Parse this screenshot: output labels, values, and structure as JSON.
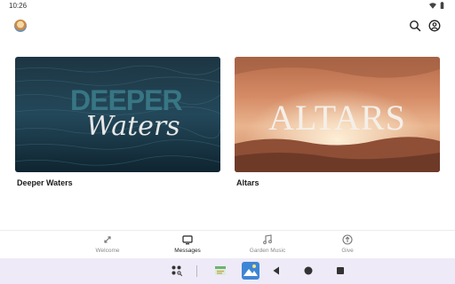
{
  "status_bar": {
    "time": "10:26"
  },
  "cards": [
    {
      "title": "Deeper Waters",
      "art_line1": "DEEPER",
      "art_line2": "Waters"
    },
    {
      "title": "Altars",
      "art_line1": "ALTARS"
    }
  ],
  "bottom_nav": [
    {
      "label": "Welcome",
      "icon": "welcome-icon",
      "active": false
    },
    {
      "label": "Messages",
      "icon": "tv-icon",
      "active": true
    },
    {
      "label": "Garden Music",
      "icon": "music-note-icon",
      "active": false
    },
    {
      "label": "Give",
      "icon": "give-icon",
      "active": false
    }
  ],
  "colors": {
    "system_bar": "#eeeaf7",
    "nav_active": "#222222",
    "nav_inactive": "#8a8a8a"
  }
}
